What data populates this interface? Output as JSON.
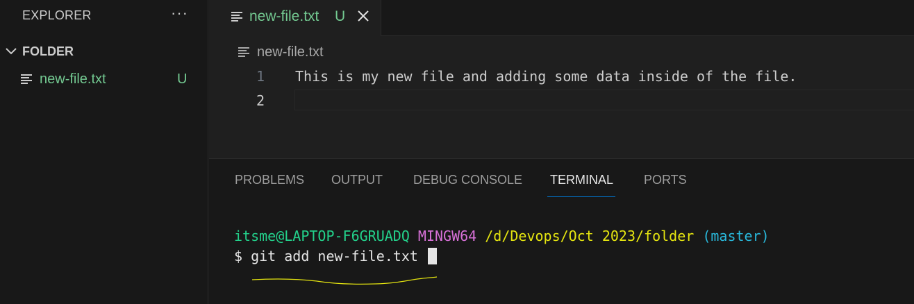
{
  "sidebar": {
    "header": "EXPLORER",
    "more_label": "···",
    "folder": {
      "label": "FOLDER",
      "expanded": true
    },
    "files": [
      {
        "name": "new-file.txt",
        "badge": "U",
        "status_color": "#73c991"
      }
    ]
  },
  "editor": {
    "tab": {
      "label": "new-file.txt",
      "badge": "U"
    },
    "breadcrumb": "new-file.txt",
    "lines": [
      {
        "number": "1",
        "text": "This is my new file and adding some data inside of the file."
      },
      {
        "number": "2",
        "text": ""
      }
    ]
  },
  "panel": {
    "tabs": [
      {
        "label": "PROBLEMS"
      },
      {
        "label": "OUTPUT"
      },
      {
        "label": "DEBUG CONSOLE"
      },
      {
        "label": "TERMINAL",
        "active": true
      },
      {
        "label": "PORTS"
      }
    ],
    "terminal": {
      "user_host": "itsme@LAPTOP-F6GRUADQ",
      "env": "MINGW64",
      "path": "/d/Devops/Oct 2023/folder",
      "branch": "(master)",
      "prompt": "$",
      "command": "git add new-file.txt"
    }
  },
  "colors": {
    "accent": "#0078d4",
    "git_untracked": "#73c991",
    "annotation": "#e5e510"
  }
}
